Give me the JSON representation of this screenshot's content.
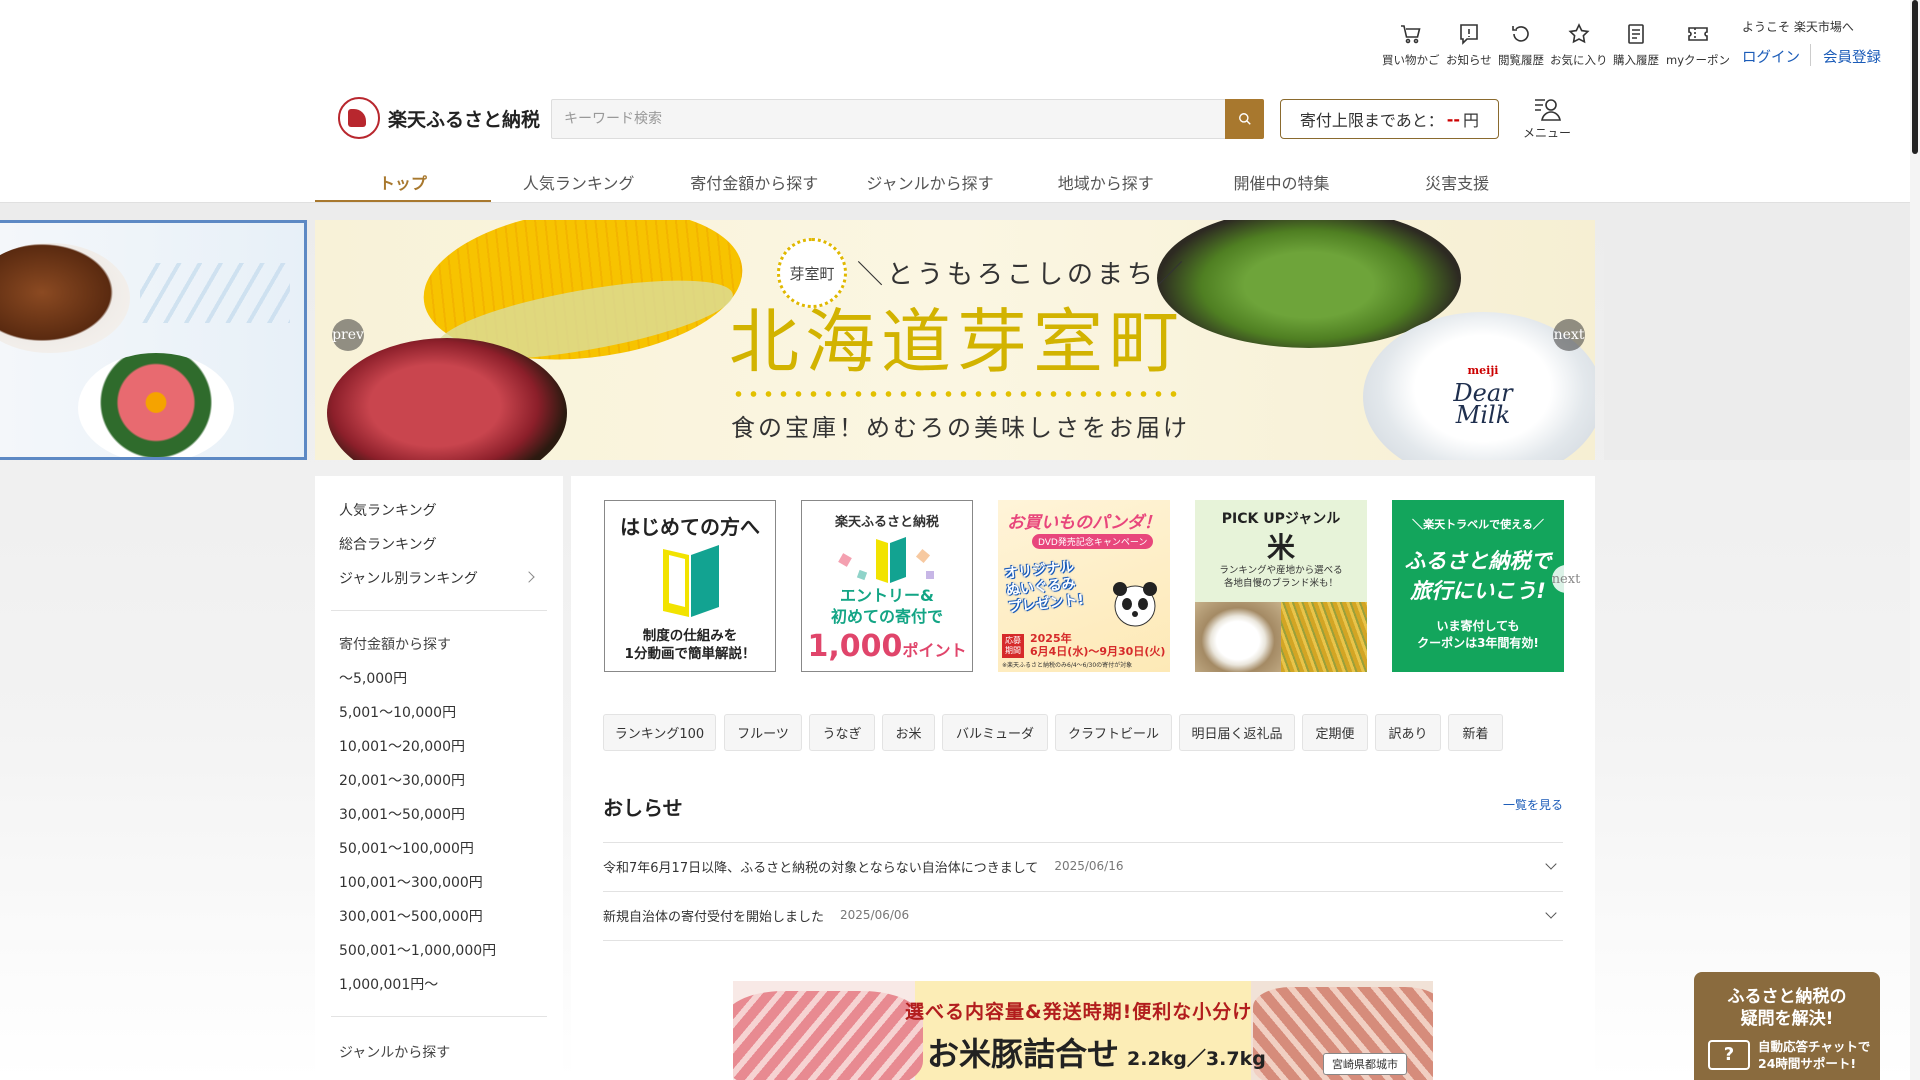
{
  "header": {
    "utilities": [
      {
        "label": "買い物かご",
        "icon": "cart-icon"
      },
      {
        "label": "お知らせ",
        "icon": "notice-icon"
      },
      {
        "label": "閲覧履歴",
        "icon": "history-icon"
      },
      {
        "label": "お気に入り",
        "icon": "star-icon"
      },
      {
        "label": "購入履歴",
        "icon": "receipt-icon"
      },
      {
        "label": "myクーポン",
        "icon": "coupon-icon"
      }
    ],
    "welcome": "ようこそ 楽天市場へ",
    "login": "ログイン",
    "register": "会員登録",
    "logo_text": "楽天ふるさと納税",
    "search_placeholder": "キーワード検索",
    "limit_prefix": "寄付上限まであと：",
    "limit_amount": "--",
    "limit_unit": "円",
    "menu_label": "メニュー"
  },
  "nav": {
    "tabs": [
      "トップ",
      "人気ランキング",
      "寄付金額から探す",
      "ジャンルから探す",
      "地域から探す",
      "開催中の特集",
      "災害支援"
    ],
    "active_index": 0
  },
  "banner": {
    "prev_label": "prev",
    "next_label": "next",
    "seal_text": "芽室町",
    "catchphrase": "＼とうもろこしのまち／",
    "headline": "北海道芽室町",
    "subline": "食の宝庫！めむろの美味しさをお届け",
    "icecream_brand": "meiji",
    "icecream_name": "Dear Milk"
  },
  "sidebar": {
    "ranking": [
      "人気ランキング",
      "総合ランキング",
      "ジャンル別ランキング"
    ],
    "amount_heading": "寄付金額から探す",
    "amounts": [
      "～5,000円",
      "5,001～10,000円",
      "10,001～20,000円",
      "20,001～30,000円",
      "30,001～50,000円",
      "50,001～100,000円",
      "100,001～300,000円",
      "300,001～500,000円",
      "500,001～1,000,000円",
      "1,000,001円～"
    ],
    "genre_heading": "ジャンルから探す"
  },
  "tiles": {
    "t1": {
      "title": "はじめての方へ",
      "sub": "制度の仕組みを\n1分動画で簡単解説！"
    },
    "t2": {
      "top": "楽天ふるさと納税",
      "mid": "エントリー&\n初めての寄付で",
      "point": "1,000",
      "point_unit": "ポイント"
    },
    "t3": {
      "title": "お買いものパンダ！",
      "campaign": "DVD発売記念キャンペーン",
      "gift": "オリジナル\nぬいぐるみ\nプレゼント!",
      "period_label": "応募期間",
      "period": "2025年\n6月4日(水)～9月30日(火)",
      "note": "※楽天ふるさと納税のみ6/4～6/30の寄付が対象"
    },
    "t4": {
      "title": "PICK UPジャンル",
      "kanji": "米",
      "sub": "ランキングや産地から選べる\n各地自慢のブランド米も！"
    },
    "t5": {
      "top": "＼楽天トラベルで使える／",
      "mid": "ふるさと納税で\n旅行にいこう!",
      "sub": "いま寄付しても\nクーポンは3年間有効!"
    },
    "next_label": "next"
  },
  "tags": [
    "ランキング100",
    "フルーツ",
    "うなぎ",
    "お米",
    "バルミューダ",
    "クラフトビール",
    "明日届く返礼品",
    "定期便",
    "訳あり",
    "新着"
  ],
  "news": {
    "title": "おしらせ",
    "more": "一覧を見る",
    "items": [
      {
        "text": "令和7年6月17日以降、ふるさと納税の対象とならない自治体につきまして",
        "date": "2025/06/16"
      },
      {
        "text": "新規自治体の寄付受付を開始しました",
        "date": "2025/06/06"
      }
    ]
  },
  "promo": {
    "line1": "選べる内容量&発送時期!便利な小分け",
    "line2": "お米豚詰合せ",
    "weight": "2.2kg／3.7kg",
    "city": "宮崎県都城市"
  },
  "chat": {
    "question": "ふるさと納税の\n疑問を解決!",
    "sub": "自動応答チャットで\n24時間サポート!"
  },
  "colors": {
    "accent": "#a8782e",
    "link": "#1a5bb8",
    "chat_bg": "#8a6b3e"
  }
}
